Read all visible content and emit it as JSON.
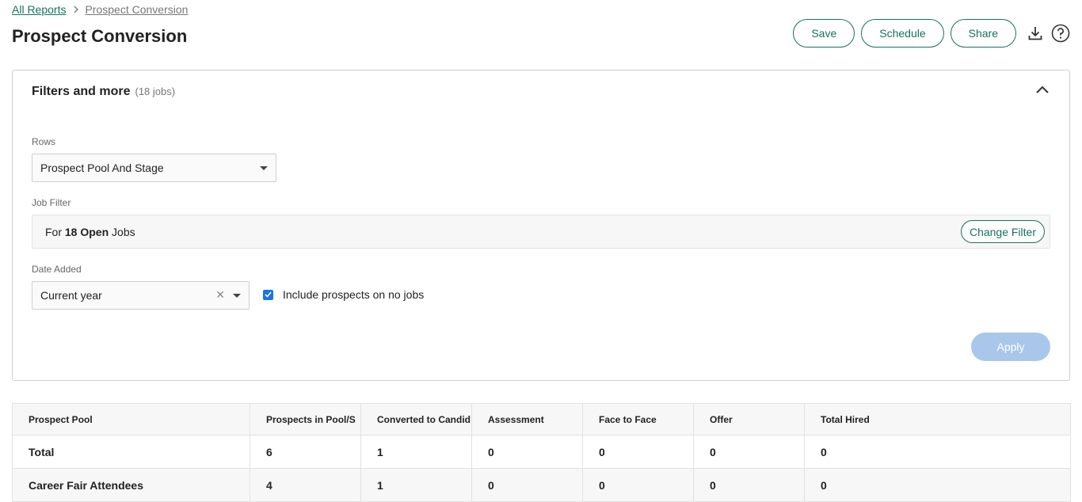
{
  "breadcrumb": {
    "root": "All Reports",
    "current": "Prospect Conversion"
  },
  "page": {
    "title": "Prospect Conversion"
  },
  "header_actions": {
    "save": "Save",
    "schedule": "Schedule",
    "share": "Share",
    "icons": [
      "download-icon",
      "help-icon"
    ]
  },
  "filters": {
    "title": "Filters and more",
    "count": "(18 jobs)",
    "rows_label": "Rows",
    "rows_value": "Prospect Pool And Stage",
    "job_filter_label": "Job Filter",
    "job_filter": {
      "prefix": "For",
      "emphasis": "18 Open",
      "suffix": "Jobs"
    },
    "change_filter": "Change Filter",
    "date_added_label": "Date Added",
    "date_added_value": "Current year",
    "include_no_jobs_label": "Include prospects on no jobs",
    "include_no_jobs_checked": true,
    "apply": "Apply"
  },
  "table": {
    "columns": [
      "Prospect Pool",
      "Prospects in Pool/S",
      "Converted to Candid",
      "Assessment",
      "Face to Face",
      "Offer",
      "Total Hired"
    ],
    "rows": [
      [
        "Total",
        "6",
        "1",
        "0",
        "0",
        "0",
        "0"
      ],
      [
        "Career Fair Attendees",
        "4",
        "1",
        "0",
        "0",
        "0",
        "0"
      ]
    ]
  },
  "colors": {
    "accent": "#16725e",
    "apply_disabled": "#a9c7ea",
    "checkbox": "#1a73e8"
  }
}
